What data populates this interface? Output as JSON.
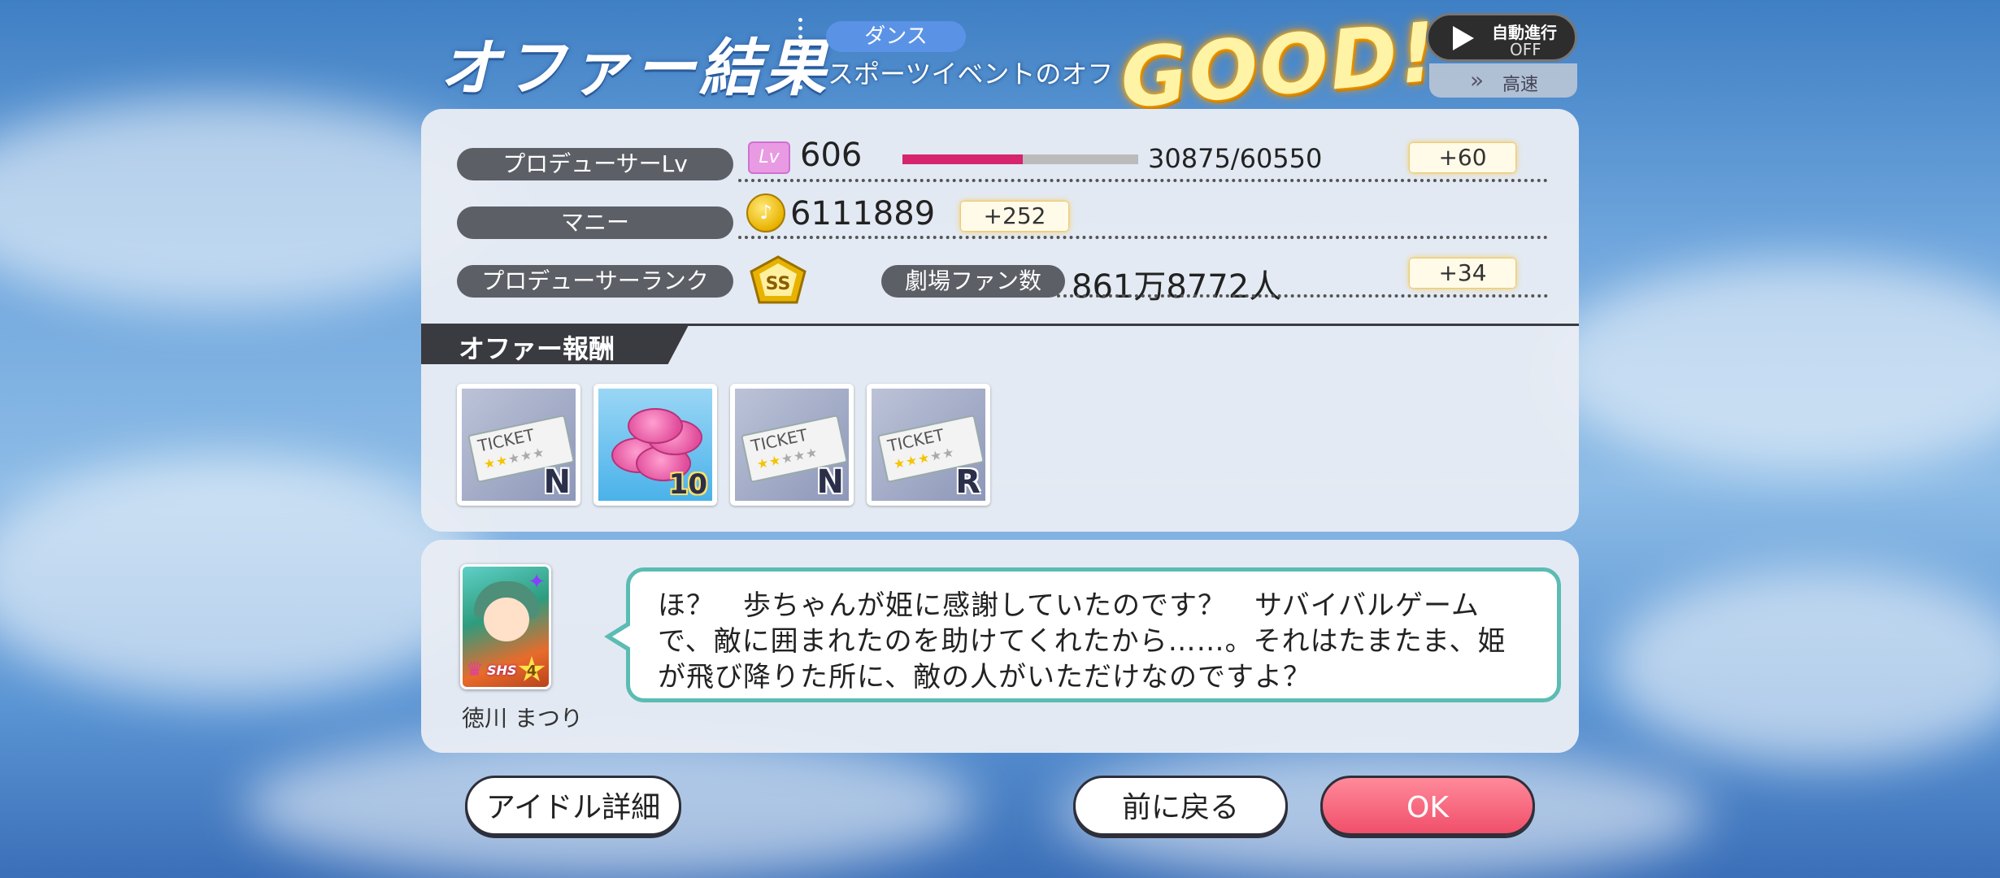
{
  "header": {
    "title": "オファー結果",
    "genre": "ダンス",
    "offer_name": "スポーツイベントのオフ",
    "result": "GOOD!",
    "auto_label": "自動進行",
    "auto_state": "OFF",
    "speed_label": "高速"
  },
  "stats": {
    "lv_label": "プロデューサーLv",
    "lv_icon": "Lv",
    "lv_value": "606",
    "exp_text": "30875/60550",
    "exp_fraction": 0.51,
    "lv_gain": "+60",
    "money_label": "マニー",
    "money_value": "6111889",
    "money_gain": "+252",
    "rank_label": "プロデューサーランク",
    "rank_value": "SS",
    "fans_label": "劇場ファン数",
    "fans_value": "861万8772人",
    "fans_gain": "+34"
  },
  "rewards": {
    "heading": "オファー報酬",
    "items": [
      {
        "icon": "ticket-icon",
        "ticket_text": "TICKET",
        "label": "N"
      },
      {
        "icon": "pink-coins-icon",
        "label": "10"
      },
      {
        "icon": "ticket-icon",
        "ticket_text": "TICKET",
        "label": "N"
      },
      {
        "icon": "ticket-icon",
        "ticket_text": "TICKET",
        "label": "R"
      }
    ]
  },
  "dialog": {
    "idol_name": "徳川 まつり",
    "idol_rarity": "SHS",
    "idol_level": "4",
    "message": "ほ？　歩ちゃんが姫に感謝していたのです？　サバイバルゲームで、敵に囲まれたのを助けてくれたから……。それはたまたま、姫が飛び降りた所に、敵の人がいただけなのですよ？"
  },
  "buttons": {
    "idol_detail": "アイドル詳細",
    "back": "前に戻る",
    "ok": "OK"
  },
  "colors": {
    "exp_bar": "#d6246e",
    "bubble_border": "#5bbcb3",
    "ok_button": "#f04f6a"
  }
}
